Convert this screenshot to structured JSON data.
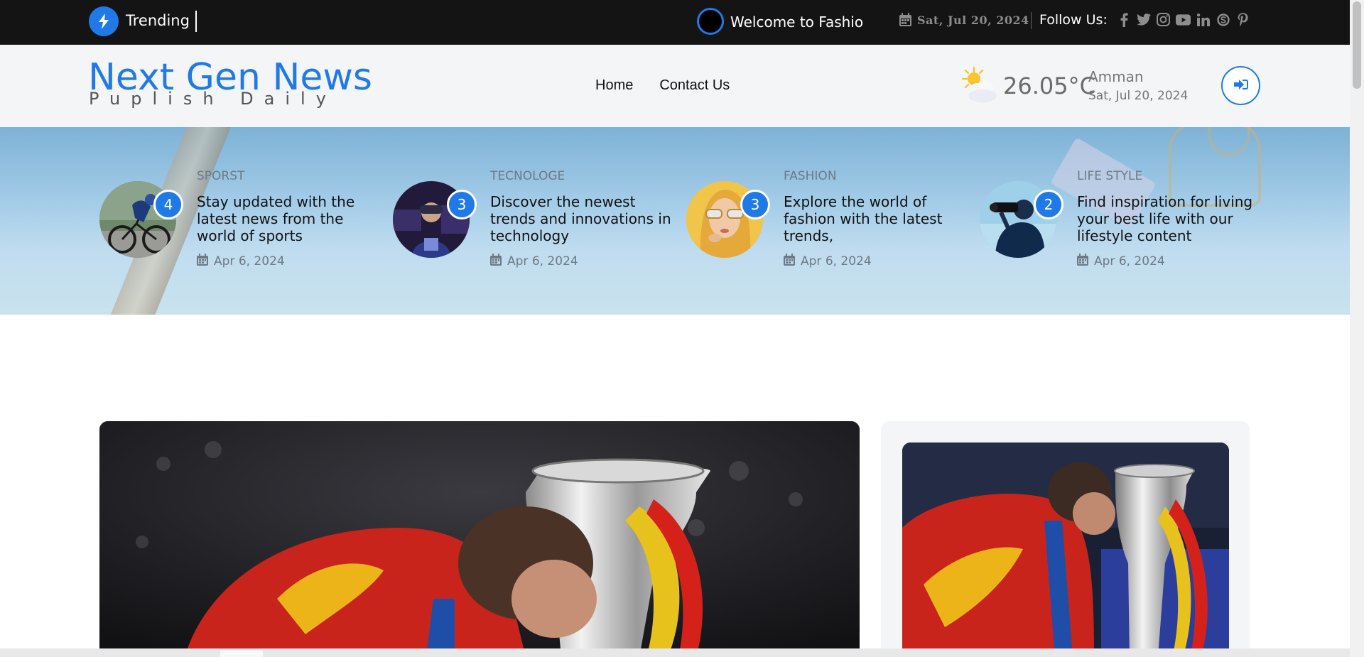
{
  "topbar": {
    "trending_label": "Trending",
    "ticker_text": "Welcome to Fashion",
    "date": "Sat, Jul 20, 2024",
    "follow_label": "Follow Us:",
    "socials": [
      "facebook-icon",
      "twitter-icon",
      "instagram-icon",
      "youtube-icon",
      "linkedin-icon",
      "skype-icon",
      "pinterest-icon"
    ]
  },
  "header": {
    "logo_title": "Next Gen News",
    "logo_sub": "Puplish Daily",
    "nav": [
      "Home",
      "Contact Us"
    ],
    "temperature": "26.05°C",
    "city": "Amman",
    "weather_date": "Sat, Jul 20, 2024"
  },
  "cards": [
    {
      "category": "SPORST",
      "count": "4",
      "title": "Stay updated with the latest news from the world of sports",
      "date": "Apr 6, 2024"
    },
    {
      "category": "TECNOLOGE",
      "count": "3",
      "title": "Discover the newest trends and innovations in technology",
      "date": "Apr 6, 2024"
    },
    {
      "category": "FASHION",
      "count": "3",
      "title": "Explore the world of fashion with the latest trends,",
      "date": "Apr 6, 2024"
    },
    {
      "category": "LIFE STYLE",
      "count": "2",
      "title": "Find inspiration for living your best life with our lifestyle content",
      "date": "Apr 6, 2024"
    }
  ],
  "colors": {
    "accent": "#1f7ae8",
    "topbar": "#141414",
    "header_bg": "#f4f5f7"
  }
}
